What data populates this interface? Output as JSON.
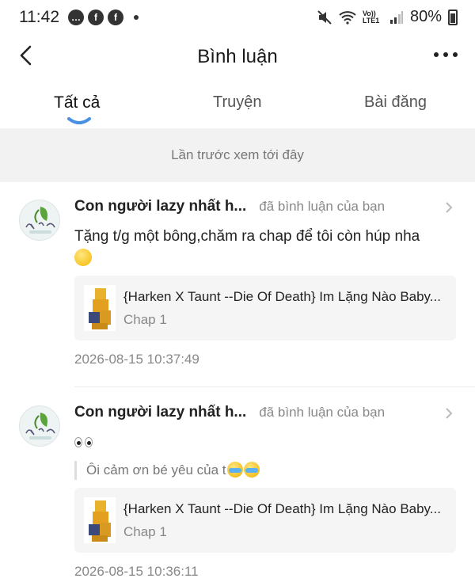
{
  "status_bar": {
    "time": "11:42",
    "signal_label": "Vo)) LTE1",
    "battery": "80%"
  },
  "header": {
    "title": "Bình luận"
  },
  "tabs": [
    {
      "label": "Tất cả",
      "active": true
    },
    {
      "label": "Truyện",
      "active": false
    },
    {
      "label": "Bài đăng",
      "active": false
    }
  ],
  "banner": "Lần trước xem tới đây",
  "comments": [
    {
      "user": "Con người lazy nhất h...",
      "action": "đã bình luận của bạn",
      "text": "Tặng t/g một bông,chăm ra chap để tôi còn húp nha",
      "story_title": "{Harken X Taunt --Die Of Death} Im Lặng Nào Baby...",
      "chapter": "Chap 1",
      "time": "2026-08-15 10:37:49"
    },
    {
      "user": "Con người lazy nhất h...",
      "action": "đã bình luận của bạn",
      "quote": "Ôi cảm ơn bé yêu của t",
      "story_title": "{Harken X Taunt --Die Of Death} Im Lặng Nào Baby...",
      "chapter": "Chap 1",
      "time": "2026-08-15 10:36:11"
    }
  ],
  "colors": {
    "accent": "#4a90e2",
    "banner_bg": "#f2f2f2",
    "card_bg": "#f5f5f5"
  }
}
